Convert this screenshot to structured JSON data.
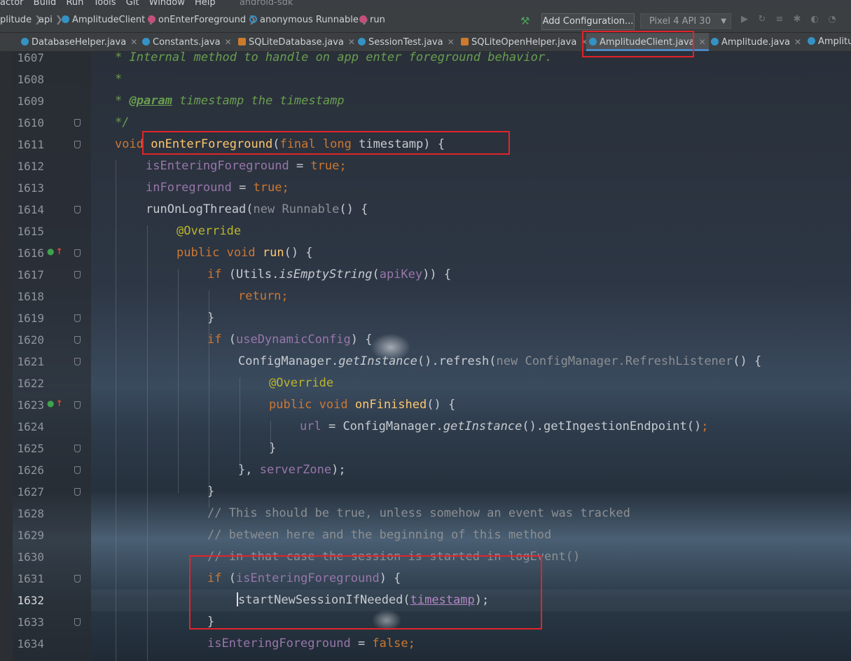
{
  "menu": {
    "items": [
      "actor",
      "Build",
      "Run",
      "Tools",
      "Git",
      "Window",
      "Help"
    ],
    "project": "android-sdk"
  },
  "breadcrumbs": [
    {
      "label": "plitude",
      "icon": "none"
    },
    {
      "label": "api",
      "icon": "none"
    },
    {
      "label": "AmplitudeClient",
      "icon": "class-icon"
    },
    {
      "label": "onEnterForeground",
      "icon": "method-icon"
    },
    {
      "label": "anonymous Runnable",
      "icon": "anonymous-class-icon"
    },
    {
      "label": "run",
      "icon": "method-icon"
    }
  ],
  "toolbar": {
    "add_configuration": "Add Configuration...",
    "device": "Pixel 4 API 30"
  },
  "tabs": [
    {
      "label": "DatabaseHelper.java",
      "active": false
    },
    {
      "label": "Constants.java",
      "active": false
    },
    {
      "label": "SQLiteDatabase.java",
      "active": false
    },
    {
      "label": "SessionTest.java",
      "active": false
    },
    {
      "label": "SQLiteOpenHelper.java",
      "active": false
    },
    {
      "label": "AmplitudeClient.java",
      "active": true
    },
    {
      "label": "Amplitude.java",
      "active": false
    },
    {
      "label": "Amplitu",
      "active": false
    }
  ],
  "code": {
    "lines": [
      "1607",
      "1608",
      "1609",
      "1610",
      "1611",
      "1612",
      "1613",
      "1614",
      "1615",
      "1616",
      "1617",
      "1618",
      "1619",
      "1620",
      "1621",
      "1622",
      "1623",
      "1624",
      "1625",
      "1626",
      "1627",
      "1628",
      "1629",
      "1630",
      "1631",
      "1632",
      "1633",
      "1634"
    ],
    "current_line": "1632",
    "l1607": "* Internal method to handle on app enter foreground behavior.",
    "l1608": "*",
    "l1609_a": "* ",
    "l1609_tag": "@param",
    "l1609_b": " timestamp the timestamp",
    "l1610": "*/",
    "k_void": "void",
    "f_onEnterForeground": "onEnterForeground",
    "p_open": "(",
    "k_final": "final",
    "k_long": "long",
    "v_timestamp": "timestamp",
    "p_close_brace": ") {",
    "fl_isEnteringForeground": "isEnteringForeground",
    "op_assign": " = ",
    "k_true": "true",
    "semi": ";",
    "fl_inForeground": "inForeground",
    "m_runOnLogThread": "runOnLogThread(",
    "k_new": "new",
    "t_runnable": "Runnable",
    "p_paren_brace": "() {",
    "a_override": "@Override",
    "k_public": "public",
    "f_run": "run",
    "k_if": "if",
    "t_utils": "(Utils.",
    "m_isEmptyString": "isEmptyString",
    "fl_apiKey": "apiKey",
    "p_dclose": ")) {",
    "k_return": "return",
    "p_rbrace": "}",
    "fl_useDynamicConfig": "useDynamicConfig",
    "t_configManager": "ConfigManager.",
    "m_getInstance": "getInstance",
    "m_refresh": "().refresh(",
    "t_refreshListener": "ConfigManager.RefreshListener",
    "f_onFinished": "onFinished",
    "fl_url": "url",
    "m_getIngestion": "().getIngestionEndpoint()",
    "p_serverzone_pre": "}, ",
    "fl_serverZone": "serverZone",
    "p_close_semi": ");",
    "c1628": "// This should be true, unless somehow an event was tracked",
    "c1629": "// between here and the beginning of this method",
    "c1630": "// in that case the session is started in logEvent()",
    "m_startNewSession": "startNewSessionIfNeeded(",
    "k_false": "false"
  },
  "colors": {
    "highlight_box": "#e0242a",
    "keyword": "#cc7832",
    "field": "#9876aa",
    "method_decl": "#ffc66d",
    "comment": "#6a9e4f"
  }
}
